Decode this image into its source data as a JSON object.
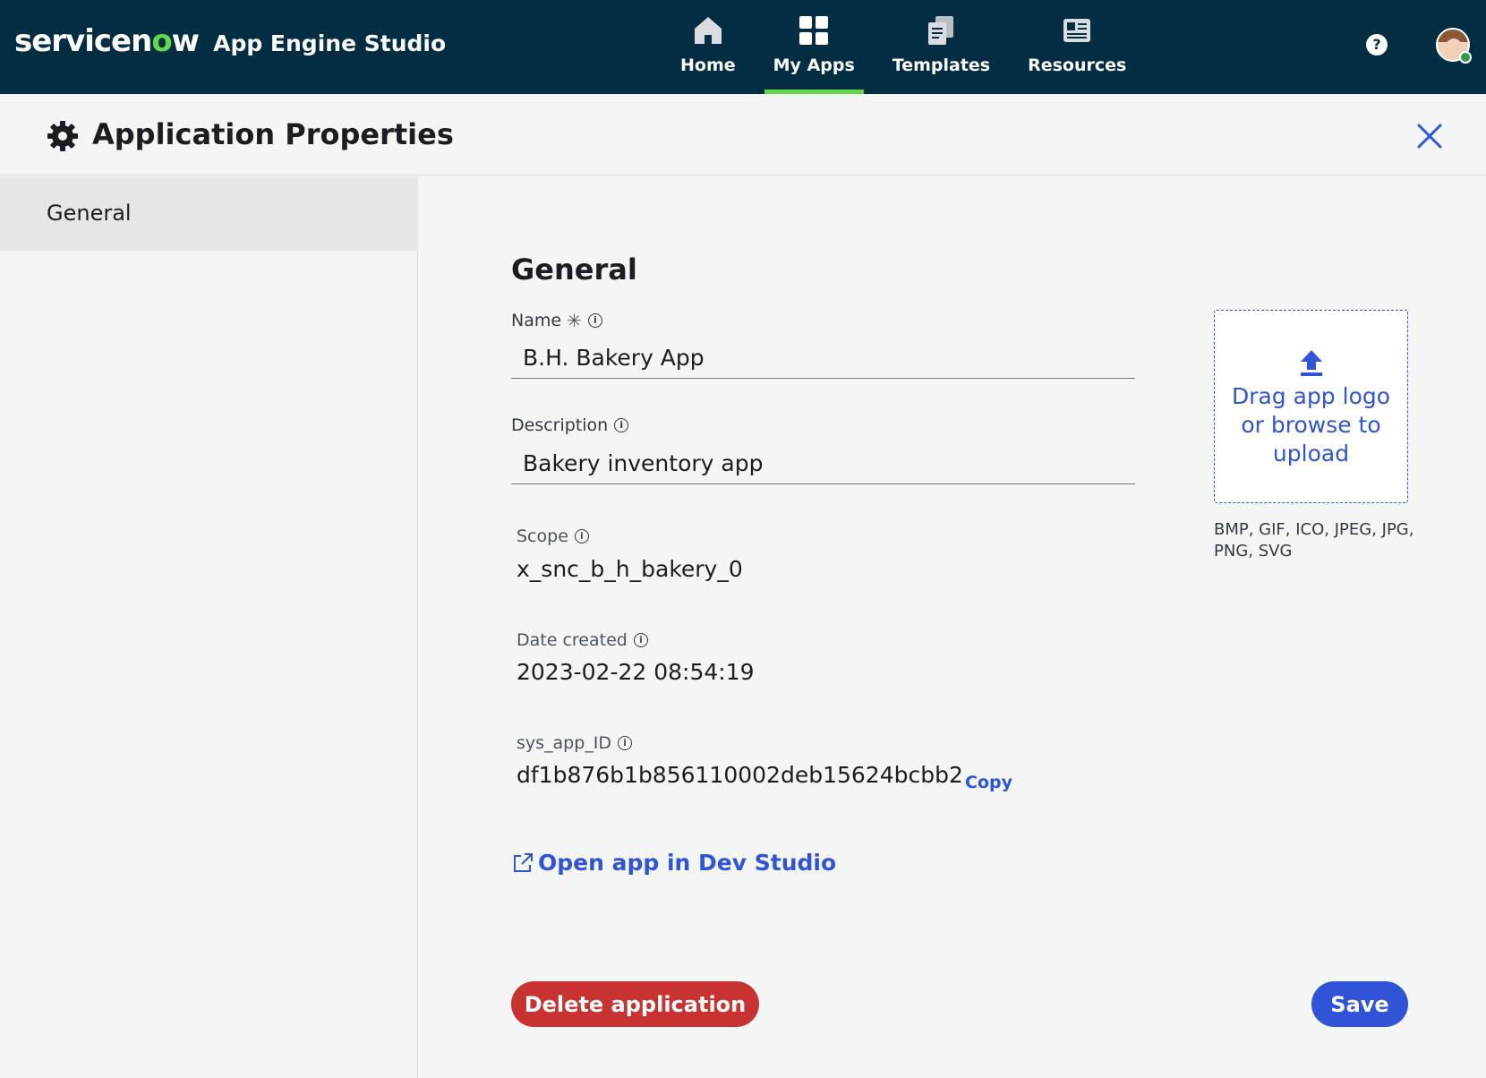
{
  "brand": {
    "logo_pre": "servicen",
    "logo_o": "o",
    "logo_post": "w",
    "product": "App Engine Studio"
  },
  "nav": {
    "items": [
      {
        "label": "Home",
        "icon": "home-icon"
      },
      {
        "label": "My Apps",
        "icon": "grid-icon",
        "active": true
      },
      {
        "label": "Templates",
        "icon": "templates-icon"
      },
      {
        "label": "Resources",
        "icon": "resources-icon"
      }
    ],
    "help": "?"
  },
  "page": {
    "title": "Application Properties"
  },
  "sidebar": {
    "items": [
      {
        "label": "General",
        "selected": true
      }
    ]
  },
  "general": {
    "title": "General",
    "name": {
      "label": "Name",
      "required_mark": "✳",
      "value": "B.H. Bakery App"
    },
    "description": {
      "label": "Description",
      "value": "Bakery inventory app"
    },
    "scope": {
      "label": "Scope",
      "value": "x_snc_b_h_bakery_0"
    },
    "date_created": {
      "label": "Date created",
      "value": "2023-02-22 08:54:19"
    },
    "sys_app_id": {
      "label": "sys_app_ID",
      "value": "df1b876b1b856110002deb15624bcbb2",
      "copy_label": "Copy"
    },
    "dev_studio_link": "Open app in Dev Studio",
    "upload": {
      "text": "Drag app logo or browse to upload",
      "formats": "BMP, GIF, ICO, JPEG, JPG, PNG, SVG"
    },
    "delete_label": "Delete application",
    "save_label": "Save"
  },
  "colors": {
    "topbar": "#032d42",
    "accent_green": "#62d84e",
    "primary_blue": "#3053d8",
    "danger_red": "#c83331"
  }
}
